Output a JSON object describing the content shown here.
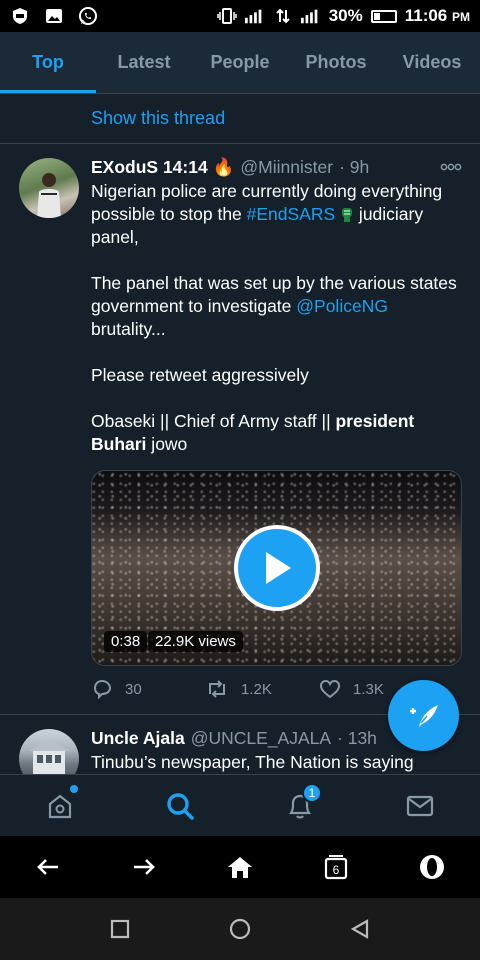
{
  "status_bar": {
    "battery": "30%",
    "time": "11:06",
    "ampm": "PM",
    "battery_level": 0.3
  },
  "tabs": [
    {
      "label": "Top",
      "active": true
    },
    {
      "label": "Latest",
      "active": false
    },
    {
      "label": "People",
      "active": false
    },
    {
      "label": "Photos",
      "active": false
    },
    {
      "label": "Videos",
      "active": false
    }
  ],
  "show_thread": "Show this thread",
  "tweet1": {
    "name": "EXoduS 14:14",
    "name_emoji": "🔥",
    "handle": "@Miinnister",
    "time": "· 9h",
    "more": "ooo",
    "p1_a": "Nigerian police are currently doing everything possible to stop the ",
    "p1_tag": "#EndSARS",
    "p1_b": " judiciary panel,",
    "p2_a": "The panel that was set up by the various states government to investigate ",
    "p2_mention": "@PoliceNG",
    "p2_b": " brutality...",
    "p3": "Please retweet aggressively",
    "p4_a": "Obaseki || Chief of Army staff || ",
    "p4_bold": "president Buhari",
    "p4_b": " jowo",
    "video": {
      "duration": "0:38",
      "views": "22.9K views"
    },
    "replies": "30",
    "retweets": "1.2K",
    "likes": "1.3K"
  },
  "tweet2": {
    "name": "Uncle Ajala",
    "handle": "@UNCLE_AJALA",
    "time": "· 13h",
    "text": "Tinubu’s newspaper, The Nation is saying"
  },
  "bottom_nav": {
    "notification_count": "1"
  },
  "browser_bar": {
    "tab_count": "6"
  },
  "colors": {
    "accent": "#1da1f2",
    "background": "#15202b",
    "muted": "#8899a6"
  }
}
